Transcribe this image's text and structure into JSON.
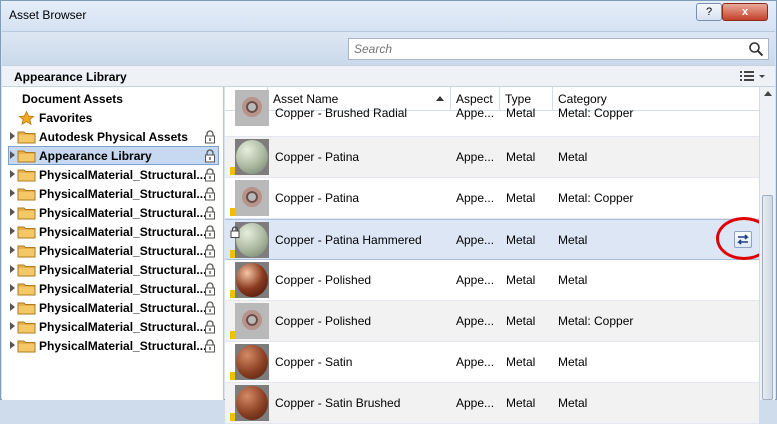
{
  "window": {
    "title": "Asset Browser",
    "help_label": "?",
    "close_label": "x"
  },
  "search": {
    "placeholder": "Search",
    "value": ""
  },
  "library": {
    "title": "Appearance Library"
  },
  "sidebar": {
    "items": [
      {
        "label": "Document Assets",
        "icon": "none",
        "locked": false,
        "expandable": false
      },
      {
        "label": "Favorites",
        "icon": "star-icon",
        "locked": false,
        "expandable": false
      },
      {
        "label": "Autodesk Physical Assets",
        "icon": "folder-icon",
        "locked": true,
        "expandable": true
      },
      {
        "label": "Appearance Library",
        "icon": "folder-icon",
        "locked": true,
        "expandable": true,
        "selected": true
      },
      {
        "label": "PhysicalMaterial_Structural...",
        "icon": "folder-icon",
        "locked": true,
        "expandable": true
      },
      {
        "label": "PhysicalMaterial_Structural...",
        "icon": "folder-icon",
        "locked": true,
        "expandable": true
      },
      {
        "label": "PhysicalMaterial_Structural...",
        "icon": "folder-icon",
        "locked": true,
        "expandable": true
      },
      {
        "label": "PhysicalMaterial_Structural...",
        "icon": "folder-icon",
        "locked": true,
        "expandable": true
      },
      {
        "label": "PhysicalMaterial_Structural...",
        "icon": "folder-icon",
        "locked": true,
        "expandable": true
      },
      {
        "label": "PhysicalMaterial_Structural...",
        "icon": "folder-icon",
        "locked": true,
        "expandable": true
      },
      {
        "label": "PhysicalMaterial_Structural...",
        "icon": "folder-icon",
        "locked": true,
        "expandable": true
      },
      {
        "label": "PhysicalMaterial_Structural...",
        "icon": "folder-icon",
        "locked": true,
        "expandable": true
      },
      {
        "label": "PhysicalMaterial_Structural...",
        "icon": "folder-icon",
        "locked": true,
        "expandable": true
      },
      {
        "label": "PhysicalMaterial_Structural...",
        "icon": "folder-icon",
        "locked": true,
        "expandable": true
      }
    ]
  },
  "table": {
    "columns": [
      "Asset Name",
      "Aspect",
      "Type",
      "Category"
    ],
    "sort_column": "Asset Name",
    "rows": [
      {
        "name": "Copper - Brushed Radial",
        "aspect": "Appe...",
        "type": "Metal",
        "category": "Metal: Copper",
        "thumb": "swirl"
      },
      {
        "name": "Copper - Patina",
        "aspect": "Appe...",
        "type": "Metal",
        "category": "Metal",
        "thumb": "patina"
      },
      {
        "name": "Copper - Patina",
        "aspect": "Appe...",
        "type": "Metal",
        "category": "Metal: Copper",
        "thumb": "swirl"
      },
      {
        "name": "Copper - Patina Hammered",
        "aspect": "Appe...",
        "type": "Metal",
        "category": "Metal",
        "thumb": "patina",
        "selected": true
      },
      {
        "name": "Copper - Polished",
        "aspect": "Appe...",
        "type": "Metal",
        "category": "Metal",
        "thumb": "polished"
      },
      {
        "name": "Copper - Polished",
        "aspect": "Appe...",
        "type": "Metal",
        "category": "Metal: Copper",
        "thumb": "swirl"
      },
      {
        "name": "Copper - Satin",
        "aspect": "Appe...",
        "type": "Metal",
        "category": "Metal",
        "thumb": "satin"
      },
      {
        "name": "Copper - Satin Brushed",
        "aspect": "Appe...",
        "type": "Metal",
        "category": "Metal",
        "thumb": "satin"
      }
    ]
  },
  "colors": {
    "selection": "#c6d9f0",
    "callout": "#e00000",
    "folder": "#e8b04a"
  }
}
